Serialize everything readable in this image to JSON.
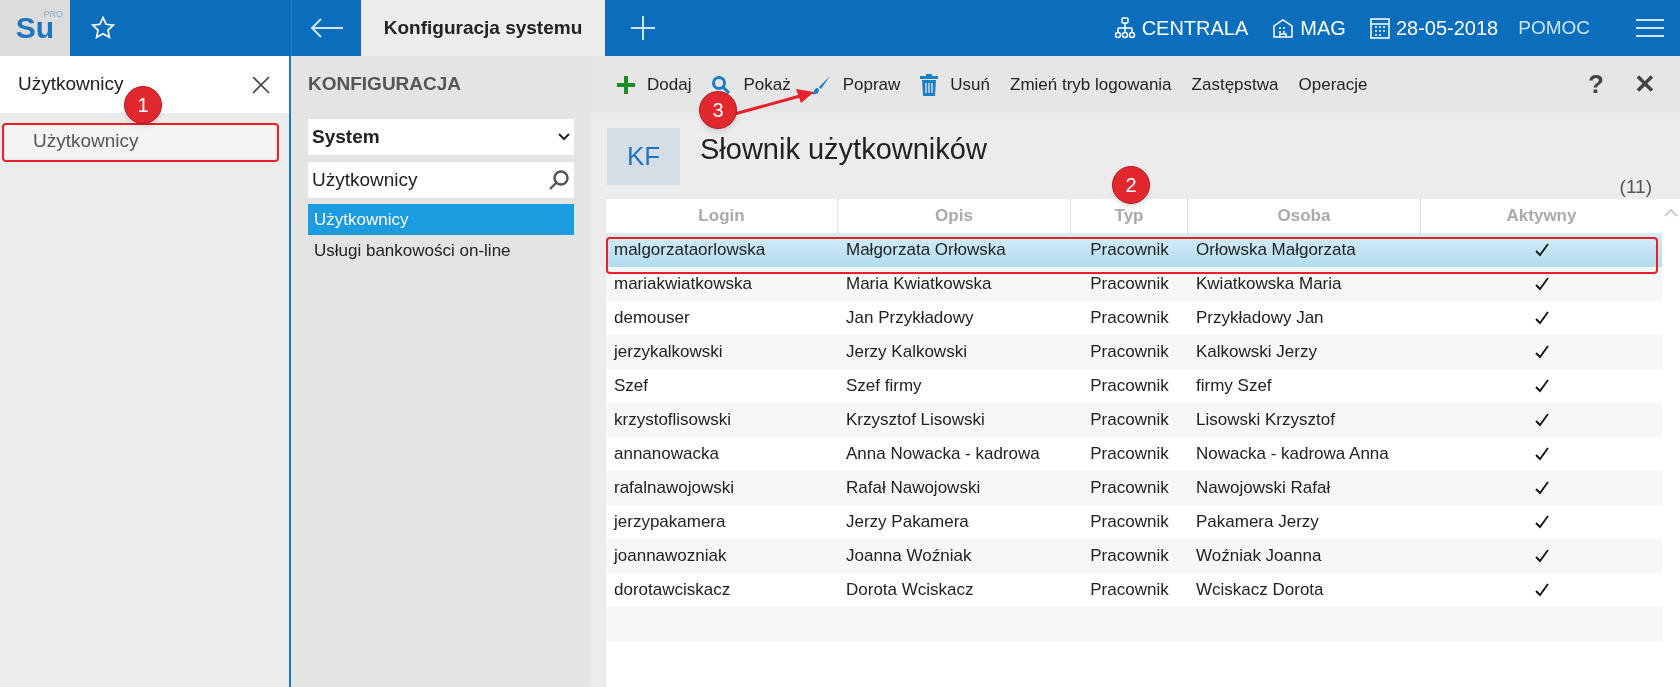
{
  "app": {
    "logo": "Su",
    "logo_badge": "PRO",
    "tab": "Konfiguracja systemu",
    "status": [
      {
        "kind": "branch",
        "label": "CENTRALA"
      },
      {
        "kind": "warehouse",
        "label": "MAG"
      },
      {
        "kind": "date",
        "label": "28-05-2018"
      }
    ],
    "help": "POMOC"
  },
  "search_panel": {
    "query": "Użytkownicy",
    "results": [
      {
        "label": "Użytkownicy",
        "selected": true
      }
    ]
  },
  "config_panel": {
    "title": "KONFIGURACJA",
    "dropdown": "System",
    "filter": "Użytkownicy",
    "items": [
      {
        "label": "Użytkownicy",
        "selected": true
      },
      {
        "label": "Usługi bankowości on-line",
        "selected": false
      }
    ]
  },
  "toolbar": [
    {
      "kind": "add",
      "label": "Dodaj"
    },
    {
      "kind": "view",
      "label": "Pokaż"
    },
    {
      "kind": "edit",
      "label": "Popraw"
    },
    {
      "kind": "delete",
      "label": "Usuń"
    },
    {
      "kind": "text",
      "label": "Zmień tryb logowania"
    },
    {
      "kind": "text",
      "label": "Zastępstwa"
    },
    {
      "kind": "text",
      "label": "Operacje"
    }
  ],
  "toolbar_right": {
    "help": "?",
    "close": "✕"
  },
  "document": {
    "badge": "KF",
    "title": "Słownik użytkowników",
    "count": "(11)"
  },
  "table": {
    "columns": [
      "Login",
      "Opis",
      "Typ",
      "Osoba",
      "Aktywny"
    ],
    "rows": [
      {
        "cells": [
          "malgorzataorlowska",
          "Małgorzata Orłowska",
          "Pracownik",
          "Orłowska Małgorzata"
        ],
        "active": true,
        "selected": true
      },
      {
        "cells": [
          "mariakwiatkowska",
          "Maria Kwiatkowska",
          "Pracownik",
          "Kwiatkowska Maria"
        ],
        "active": true,
        "selected": false
      },
      {
        "cells": [
          "demouser",
          "Jan Przykładowy",
          "Pracownik",
          "Przykładowy Jan"
        ],
        "active": true,
        "selected": false
      },
      {
        "cells": [
          "jerzykalkowski",
          "Jerzy Kalkowski",
          "Pracownik",
          "Kalkowski Jerzy"
        ],
        "active": true,
        "selected": false
      },
      {
        "cells": [
          "Szef",
          "Szef firmy",
          "Pracownik",
          "firmy Szef"
        ],
        "active": true,
        "selected": false
      },
      {
        "cells": [
          "krzystoflisowski",
          "Krzysztof Lisowski",
          "Pracownik",
          "Lisowski Krzysztof"
        ],
        "active": true,
        "selected": false
      },
      {
        "cells": [
          "annanowacka",
          "Anna Nowacka - kadrowa",
          "Pracownik",
          "Nowacka - kadrowa Anna"
        ],
        "active": true,
        "selected": false
      },
      {
        "cells": [
          "rafalnawojowski",
          "Rafał Nawojowski",
          "Pracownik",
          "Nawojowski Rafał"
        ],
        "active": true,
        "selected": false
      },
      {
        "cells": [
          "jerzypakamera",
          "Jerzy Pakamera",
          "Pracownik",
          "Pakamera Jerzy"
        ],
        "active": true,
        "selected": false
      },
      {
        "cells": [
          "joannawozniak",
          "Joanna Woźniak",
          "Pracownik",
          "Woźniak Joanna"
        ],
        "active": true,
        "selected": false
      },
      {
        "cells": [
          "dorotawciskacz",
          "Dorota Wciskacz",
          "Pracownik",
          "Wciskacz Dorota"
        ],
        "active": true,
        "selected": false
      }
    ]
  },
  "annotations": [
    {
      "label": "1"
    },
    {
      "label": "2"
    },
    {
      "label": "3"
    }
  ]
}
